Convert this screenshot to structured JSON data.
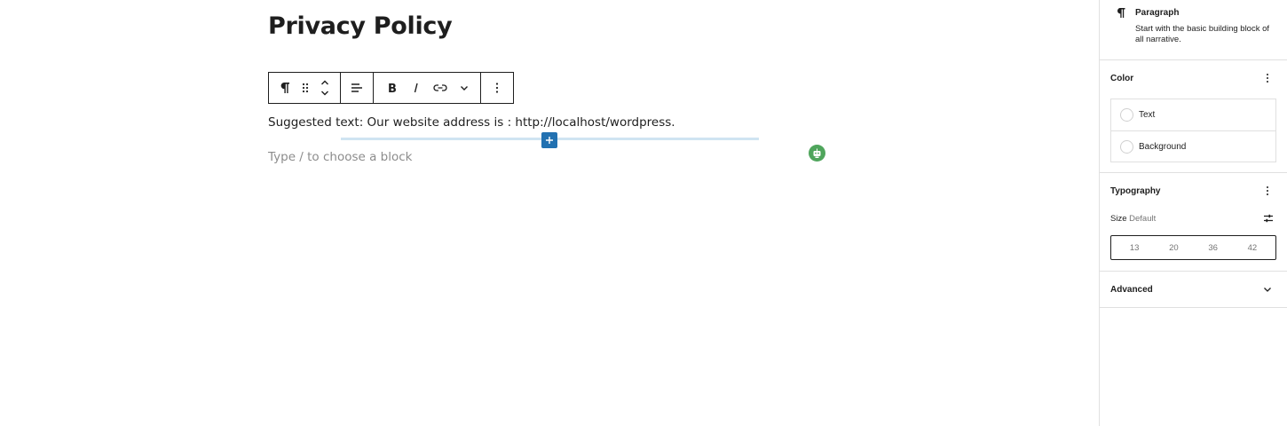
{
  "editor": {
    "title": "Privacy Policy",
    "paragraph_text": "Suggested text: Our website address is : http://localhost/wordpress.",
    "placeholder": "Type / to choose a block",
    "inserter_symbol": "+"
  },
  "toolbar": {
    "icons": [
      "pilcrow-icon",
      "drag-handle-icon",
      "move-up-icon",
      "move-down-icon",
      "align-left-icon",
      "bold-icon",
      "italic-icon",
      "link-icon",
      "chevron-down-icon",
      "more-options-icon"
    ]
  },
  "sidebar": {
    "block_card": {
      "title": "Paragraph",
      "description": "Start with the basic building block of all narrative."
    },
    "color": {
      "title": "Color",
      "items": [
        {
          "label": "Text"
        },
        {
          "label": "Background"
        }
      ]
    },
    "typography": {
      "title": "Typography",
      "size_label": "Size",
      "size_value": "Default",
      "sizes": [
        "13",
        "20",
        "36",
        "42"
      ]
    },
    "advanced": {
      "title": "Advanced"
    }
  },
  "colors": {
    "accent": "#2271b1",
    "inserter_line": "#cfe4f2",
    "avatar": "#4fa55c",
    "border": "#e0e0e0"
  }
}
